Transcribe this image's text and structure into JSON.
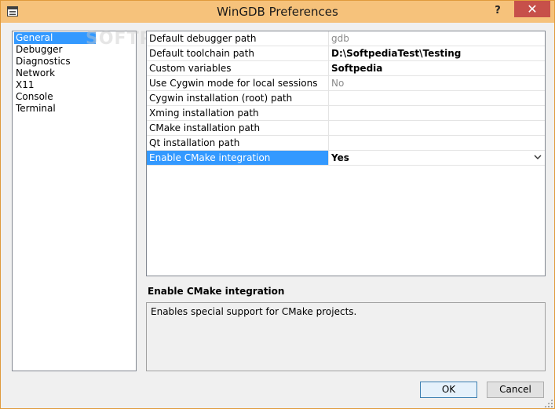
{
  "window": {
    "title": "WinGDB Preferences",
    "help_glyph": "?",
    "close_glyph": "✕",
    "watermark": "SOFTPEDIA"
  },
  "categories": [
    {
      "label": "General",
      "selected": true
    },
    {
      "label": "Debugger",
      "selected": false
    },
    {
      "label": "Diagnostics",
      "selected": false
    },
    {
      "label": "Network",
      "selected": false
    },
    {
      "label": "X11",
      "selected": false
    },
    {
      "label": "Console",
      "selected": false
    },
    {
      "label": "Terminal",
      "selected": false
    }
  ],
  "properties": [
    {
      "name": "Default debugger path",
      "value": "gdb",
      "style": "grey"
    },
    {
      "name": "Default toolchain path",
      "value": "D:\\SoftpediaTest\\Testing",
      "style": "bold"
    },
    {
      "name": "Custom variables",
      "value": "Softpedia",
      "style": "bold"
    },
    {
      "name": "Use Cygwin mode for local sessions",
      "value": "No",
      "style": "grey"
    },
    {
      "name": "Cygwin installation (root) path",
      "value": "",
      "style": ""
    },
    {
      "name": "Xming installation path",
      "value": "",
      "style": ""
    },
    {
      "name": "CMake installation path",
      "value": "",
      "style": ""
    },
    {
      "name": "Qt installation path",
      "value": "",
      "style": ""
    },
    {
      "name": "Enable CMake integration",
      "value": "Yes",
      "style": "bold"
    }
  ],
  "description": {
    "title": "Enable CMake integration",
    "text": "Enables special support for CMake projects."
  },
  "buttons": {
    "ok": "OK",
    "cancel": "Cancel"
  },
  "colors": {
    "titlebar": "#f6c27b",
    "selection": "#3399ff",
    "close_button": "#c7504a"
  }
}
